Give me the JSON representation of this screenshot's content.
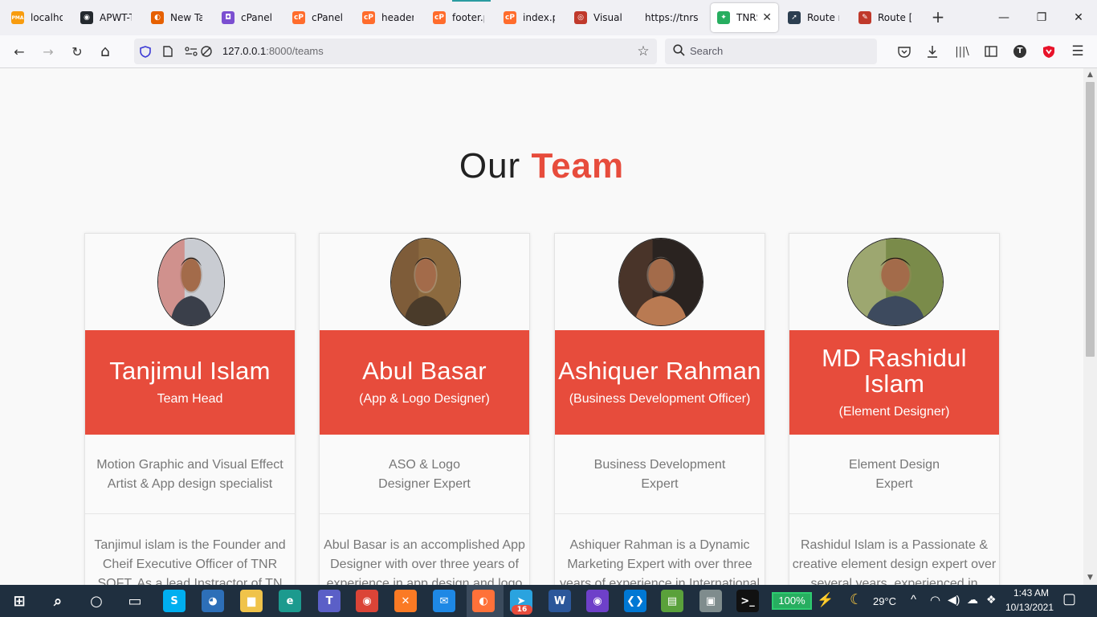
{
  "browser": {
    "tabs": [
      {
        "label": "localhos",
        "icon": "phpmyadmin-icon",
        "color": "#f89c0e",
        "glyph": "PMA"
      },
      {
        "label": "APWT-T",
        "icon": "github-icon",
        "color": "#24292e",
        "glyph": "◉"
      },
      {
        "label": "New Tab",
        "icon": "firefox-icon",
        "color": "#e66000",
        "glyph": "◐"
      },
      {
        "label": "cPanel -",
        "icon": "cpanel-purple-icon",
        "color": "#7b4fd1",
        "glyph": "◘"
      },
      {
        "label": "cPanel F",
        "icon": "cpanel-icon",
        "color": "#ff6c2c",
        "glyph": "cP"
      },
      {
        "label": "header.p",
        "icon": "cpanel-icon",
        "color": "#ff6c2c",
        "glyph": "cP"
      },
      {
        "label": "footer.pl",
        "icon": "cpanel-icon",
        "color": "#ff6c2c",
        "glyph": "cP"
      },
      {
        "label": "index.ph",
        "icon": "cpanel-icon",
        "color": "#ff6c2c",
        "glyph": "cP"
      },
      {
        "label": "Visual Pa",
        "icon": "visual-paradigm-icon",
        "color": "#c0392b",
        "glyph": "◎"
      },
      {
        "label": "https://tnrso",
        "icon": "none",
        "color": "",
        "glyph": ""
      },
      {
        "label": "TNRS",
        "icon": "tnr-icon",
        "color": "#27ae60",
        "glyph": "✦",
        "active": true
      },
      {
        "label": "Route nc",
        "icon": "route-icon",
        "color": "#2c3e50",
        "glyph": "➚"
      },
      {
        "label": "Route [h",
        "icon": "route-pencil-icon",
        "color": "#c0392b",
        "glyph": "✎"
      }
    ],
    "tab_close_glyph": "✕",
    "new_tab_glyph": "+",
    "window_controls": {
      "minimize": "—",
      "restore": "❐",
      "close": "✕"
    },
    "url": {
      "host": "127.0.0.1",
      "rest": ":8000/teams"
    },
    "search_placeholder": "Search",
    "nav_glyphs": {
      "back": "←",
      "forward": "→",
      "reload": "↻",
      "home": "⌂",
      "bookmark": "☆",
      "search": "⌕"
    },
    "toolbar_glyphs": {
      "pocket": "◫",
      "download": "⤓",
      "library": "|||\\",
      "sidebar": "▤",
      "account": "T",
      "shield": "▼",
      "menu": "☰"
    }
  },
  "page": {
    "title_plain": "Our",
    "title_accent": "Team",
    "accent_color": "#e74c3c",
    "members": [
      {
        "name": "Tanjimul Islam",
        "role": "Team Head",
        "skill": "Motion Graphic and Visual Effect Artist & App design specialist",
        "bio": "Tanjimul islam is the Founder and Cheif Executive Officer of TNR SOFT. As a lead Instractor of TN",
        "photo_colors": [
          "#c9ccd2",
          "#3a3f4a",
          "#7c5a44",
          "#d94a3a"
        ]
      },
      {
        "name": "Abul Basar",
        "role": "(App & Logo Designer)",
        "skill": "ASO & Logo\nDesigner Expert",
        "bio": "Abul Basar is an accomplished App Designer with over three years of experience in app design and logo",
        "photo_colors": [
          "#8c6a3f",
          "#4a3b2a",
          "#efefef",
          "#6d4c33"
        ]
      },
      {
        "name": "Ashiquer Rahman",
        "role": "(Business Development Officer)",
        "skill": "Business Development\nExpert",
        "bio": "Ashiquer Rahman is a Dynamic Marketing Expert with over three years of experience in International",
        "photo_colors": [
          "#2a2320",
          "#b97a52",
          "#f1ece4",
          "#6e4a35"
        ]
      },
      {
        "name": "MD Rashidul Islam",
        "role": "(Element Designer)",
        "skill": "Element Design\nExpert",
        "bio": "Rashidul Islam is a Passionate & creative element design expert over several years, experienced in",
        "photo_colors": [
          "#7a8b4a",
          "#3d4a5e",
          "#b08a62",
          "#c7c9a0"
        ]
      }
    ]
  },
  "taskbar": {
    "apps": [
      {
        "name": "start-button",
        "glyph": "⊞",
        "color": ""
      },
      {
        "name": "search-taskbar-button",
        "glyph": "⌕",
        "color": ""
      },
      {
        "name": "cortana-button",
        "glyph": "○",
        "color": ""
      },
      {
        "name": "task-view-button",
        "glyph": "▭",
        "color": ""
      },
      {
        "name": "skype-taskbar-button",
        "glyph": "S",
        "color": "#00aff0"
      },
      {
        "name": "app-taskbar-button",
        "glyph": "◕",
        "color": "#2d6fb8"
      },
      {
        "name": "file-explorer-taskbar-button",
        "glyph": "▆",
        "color": "#f0c34a"
      },
      {
        "name": "edge-taskbar-button",
        "glyph": "e",
        "color": "#1c9a8e"
      },
      {
        "name": "teams-taskbar-button",
        "glyph": "T",
        "color": "#5b5fc7"
      },
      {
        "name": "chrome-taskbar-button",
        "glyph": "◉",
        "color": "#db4437"
      },
      {
        "name": "xampp-taskbar-button",
        "glyph": "✕",
        "color": "#fb7a24"
      },
      {
        "name": "mail-taskbar-button",
        "glyph": "✉",
        "color": "#1e88e5"
      },
      {
        "name": "firefox-taskbar-button",
        "glyph": "◐",
        "color": "#ff7139"
      },
      {
        "name": "telegram-taskbar-button",
        "glyph": "➤",
        "color": "#2aa3df"
      },
      {
        "name": "word-taskbar-button",
        "glyph": "W",
        "color": "#2b579a"
      },
      {
        "name": "github-desktop-taskbar-button",
        "glyph": "◉",
        "color": "#6e40c9"
      },
      {
        "name": "vscode-taskbar-button",
        "glyph": "❮❯",
        "color": "#0078d4"
      },
      {
        "name": "notepad-taskbar-button",
        "glyph": "▤",
        "color": "#5aa13b"
      },
      {
        "name": "control-taskbar-button",
        "glyph": "▣",
        "color": "#7f8c8d"
      },
      {
        "name": "terminal-taskbar-button",
        "glyph": ">_",
        "color": "#111111"
      }
    ],
    "telegram_badge": "16",
    "battery": "100%",
    "battery_level": 1.0,
    "weather_icon": "☾",
    "temperature": "29°C",
    "tray_glyphs": {
      "up": "^",
      "network": "◠",
      "volume": "🔊",
      "onedrive": "☁",
      "dropbox": "❖"
    },
    "time": "1:43 AM",
    "date": "10/13/2021",
    "notification_glyph": "▢"
  }
}
